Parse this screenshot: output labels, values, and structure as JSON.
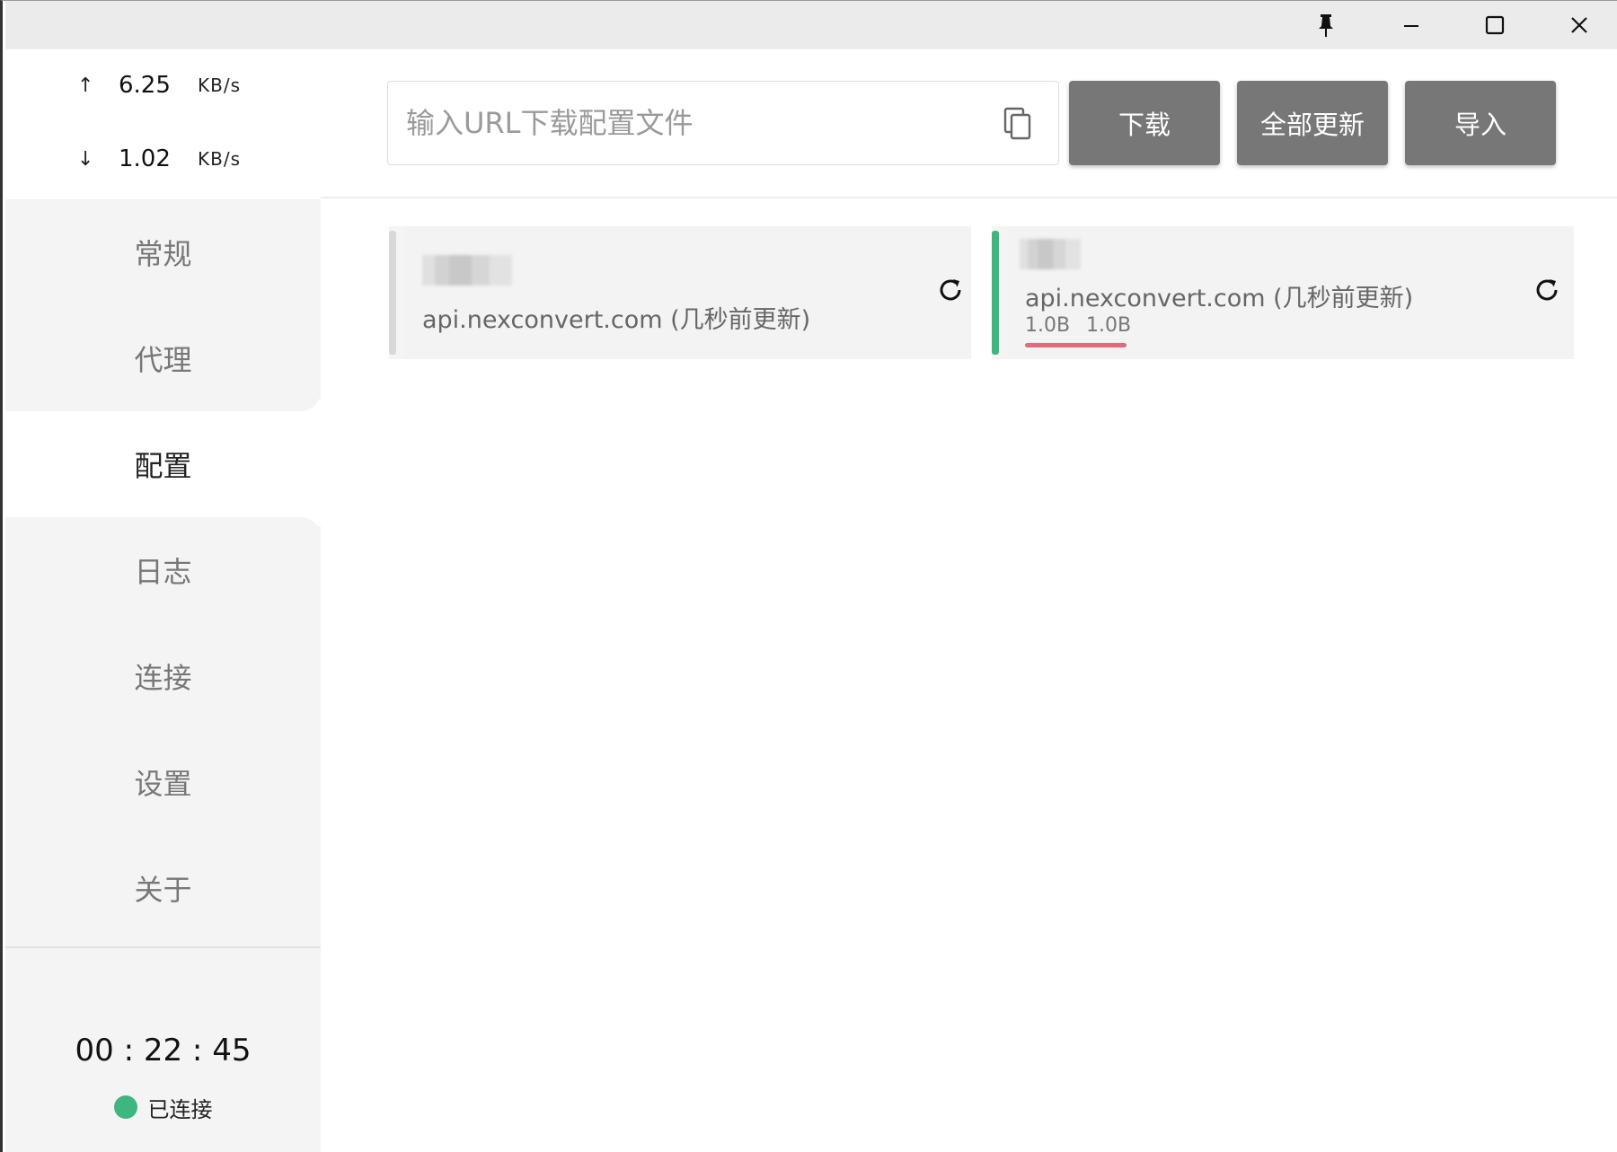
{
  "titlebar": {
    "icons": [
      "pin-icon",
      "minimize-icon",
      "maximize-icon",
      "close-icon"
    ]
  },
  "traffic": {
    "upload_arrow": "↑",
    "upload_value": "6.25",
    "upload_unit": "KB/s",
    "download_arrow": "↓",
    "download_value": "1.02",
    "download_unit": "KB/s"
  },
  "nav": {
    "items": [
      {
        "label": "常规"
      },
      {
        "label": "代理"
      },
      {
        "label": "配置"
      },
      {
        "label": "日志"
      },
      {
        "label": "连接"
      },
      {
        "label": "设置"
      },
      {
        "label": "关于"
      }
    ],
    "active_index": 2
  },
  "footer": {
    "timer": "00 : 22 : 45",
    "status_text": "已连接",
    "status_color": "#3fb57f"
  },
  "toolbar": {
    "url_placeholder": "输入URL下载配置文件",
    "url_value": "",
    "download_label": "下载",
    "update_all_label": "全部更新",
    "import_label": "导入",
    "button_color": "#777777"
  },
  "profiles": [
    {
      "source": "api.nexconvert.com (几秒前更新)",
      "selected": false,
      "indicator_color": "#d8d8d8",
      "upload": "",
      "download": ""
    },
    {
      "source": "api.nexconvert.com (几秒前更新)",
      "selected": true,
      "indicator_color": "#3fb57f",
      "upload": "1.0B",
      "download": "1.0B",
      "underline_color": "#e06c7a"
    }
  ]
}
